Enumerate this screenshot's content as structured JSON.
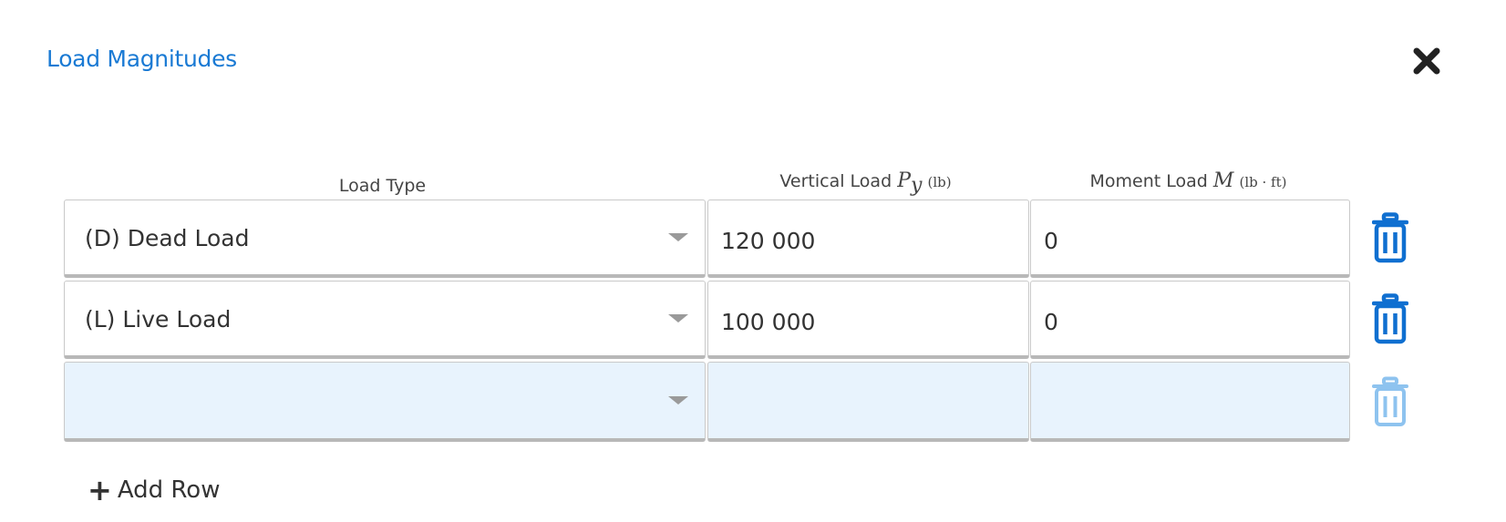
{
  "dialog": {
    "title": "Load Magnitudes",
    "close_icon": "close-icon"
  },
  "columns": {
    "load_type": "Load Type",
    "vertical_label": "Vertical Load",
    "vertical_symbol": "P",
    "vertical_subscript": "y",
    "vertical_unit": "(lb)",
    "moment_label": "Moment Load",
    "moment_symbol": "M",
    "moment_unit": "(lb · ft)"
  },
  "rows": [
    {
      "load_type": "(D) Dead Load",
      "vertical": "120 000",
      "moment": "0",
      "empty": false
    },
    {
      "load_type": "(L) Live Load",
      "vertical": "100 000",
      "moment": "0",
      "empty": false
    },
    {
      "load_type": "",
      "vertical": "",
      "moment": "",
      "empty": true
    }
  ],
  "actions": {
    "add_row_label": "Add Row",
    "add_row_icon": "plus-icon",
    "delete_icon": "trash-icon"
  },
  "colors": {
    "accent": "#1a7ad4",
    "trash_active": "#0f6fd0",
    "trash_disabled": "#8ec3ef",
    "empty_row_bg": "#e8f3fd"
  }
}
